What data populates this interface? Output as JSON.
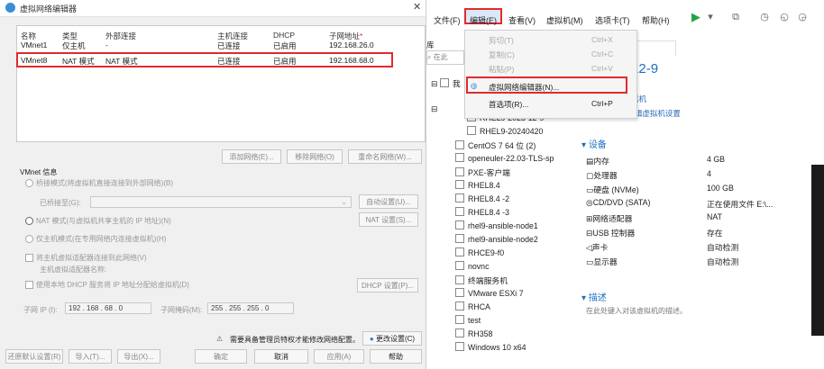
{
  "dialog": {
    "title": "虚拟网络编辑器",
    "columns": [
      "名称",
      "类型",
      "外部连接",
      "主机连接",
      "DHCP",
      "子网地址"
    ],
    "rows": [
      [
        "VMnet1",
        "仅主机",
        "-",
        "已连接",
        "已启用",
        "192.168.26.0"
      ],
      [
        "VMnet8",
        "NAT 模式",
        "NAT 模式",
        "已连接",
        "已启用",
        "192.168.68.0"
      ]
    ],
    "net_buttons": [
      "添加网络(E)...",
      "移除网络(O)",
      "重命名网络(W)..."
    ],
    "vmnet_info": "VMnet 信息",
    "bridge_label": "桥接模式(将虚拟机直接连接到外部网络)(B)",
    "bridge_to": "已桥接至(G):",
    "auto_setting": "自动设置(U)...",
    "nat_label": "NAT 模式(与虚拟机共享主机的 IP 地址)(N)",
    "nat_setting": "NAT 设置(S)...",
    "hostonly_label": "仅主机模式(在专用网络内连接虚拟机)(H)",
    "connect_adapter": "将主机虚拟适配器连接到此网络(V)",
    "adapter_name": "主机虚拟适配器名称:",
    "use_dhcp": "使用本地 DHCP 服务将 IP 地址分配给虚拟机(D)",
    "dhcp_setting": "DHCP 设置(P)...",
    "subnet_ip_label": "子网 IP (I):",
    "subnet_ip": "192 . 168 . 68 . 0",
    "subnet_mask_label": "子网掩码(M):",
    "subnet_mask": "255 . 255 . 255 . 0",
    "admin_note": "需要具备管理员特权才能修改网络配置。",
    "change_settings": "更改设置(C)",
    "bottom_buttons": [
      "还原默认设置(R)",
      "导入(T)...",
      "导出(X)...",
      "确定",
      "取消",
      "应用(A)",
      "帮助"
    ]
  },
  "app": {
    "menu": [
      "文件(F)",
      "编辑(E)",
      "查看(V)",
      "虚拟机(M)",
      "选项卡(T)",
      "帮助(H)"
    ],
    "edit_menu": [
      {
        "label": "剪切(T)",
        "shortcut": "Ctrl+X"
      },
      {
        "label": "复制(C)",
        "shortcut": "Ctrl+C"
      },
      {
        "label": "粘贴(P)",
        "shortcut": "Ctrl+V"
      },
      {
        "label": "虚拟网络编辑器(N)...",
        "shortcut": ""
      },
      {
        "label": "首选项(R)...",
        "shortcut": "Ctrl+P"
      }
    ],
    "library_label": "库",
    "search_placeholder": "在此",
    "tree": [
      "我",
      "RHEL9-2023-12-9",
      "RHEL9-20240420",
      "CentOS 7 64 位 (2)",
      "openeuler-22.03-TLS-sp",
      "PXE-客户端",
      "RHEL8.4",
      "RHEL8.4 -2",
      "RHEL8.4 -3",
      "rhel9-ansible-node1",
      "rhel9-ansible-node2",
      "RHCE9-f0",
      "novnc",
      "终端服务机",
      "VMware ESXi 7",
      "RHCA",
      "test",
      "RH358",
      "Windows 10 x64"
    ],
    "tab_label": "23-12-9",
    "vm_title": "L9-2023-12-9",
    "link1": "拟机",
    "link2": "编辑虚拟机设置",
    "devices_title": "设备",
    "devices": [
      [
        "内存",
        "4 GB"
      ],
      [
        "处理器",
        "4"
      ],
      [
        "硬盘 (NVMe)",
        "100 GB"
      ],
      [
        "CD/DVD (SATA)",
        "正在使用文件 E:\\..."
      ],
      [
        "网络适配器",
        "NAT"
      ],
      [
        "USB 控制器",
        "存在"
      ],
      [
        "声卡",
        "自动检测"
      ],
      [
        "显示器",
        "自动检测"
      ]
    ],
    "desc_title": "描述",
    "desc_text": "在此处键入对该虚拟机的描述。",
    "colors": {
      "highlight": "#e02b2b",
      "accent": "#1e6fc2"
    }
  }
}
